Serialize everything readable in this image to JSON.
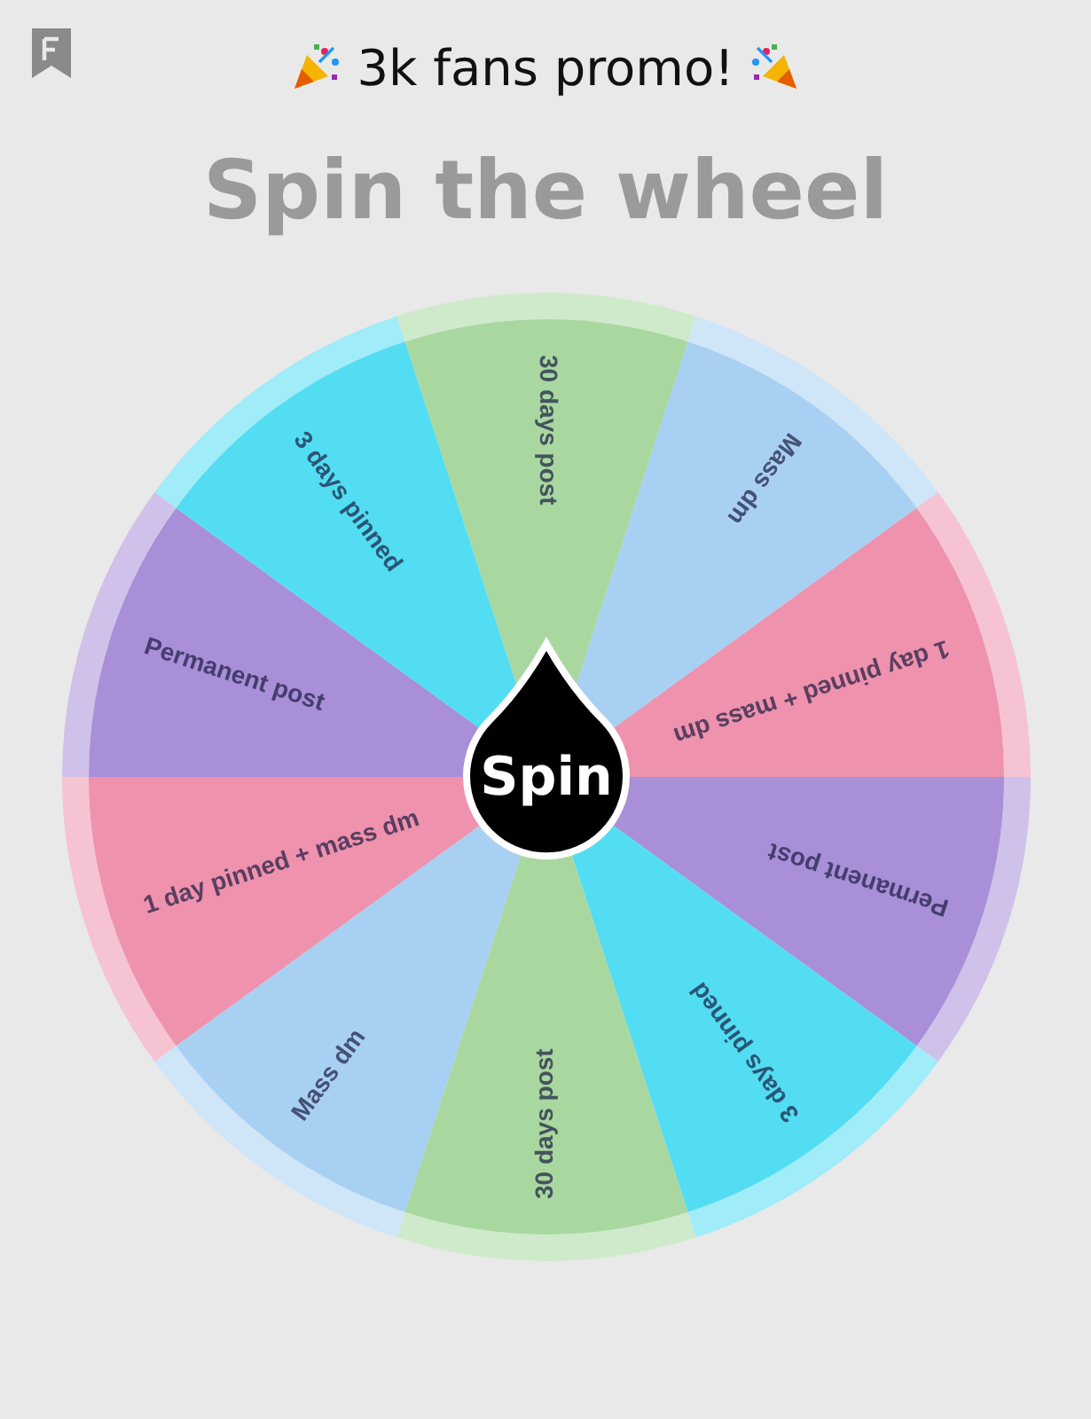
{
  "header": {
    "title": "3k fans promo!"
  },
  "heading": "Spin the wheel",
  "wheel": {
    "button": "Spin",
    "segments": [
      {
        "label": "30 days post",
        "color": "#a8d8a0"
      },
      {
        "label": "Mass dm",
        "color": "#a8d0f2"
      },
      {
        "label": "1 day pinned + mass dm",
        "color": "#ee92ad"
      },
      {
        "label": "Permanent post",
        "color": "#a88fd8"
      },
      {
        "label": "3 days pinned",
        "color": "#52ddf2"
      },
      {
        "label": "30 days post",
        "color": "#a8d8a0"
      },
      {
        "label": "Mass dm",
        "color": "#a8d0f2"
      },
      {
        "label": "1 day pinned + mass dm",
        "color": "#ee92ad"
      },
      {
        "label": "Permanent post",
        "color": "#a88fd8"
      },
      {
        "label": "3 days pinned",
        "color": "#52ddf2"
      }
    ]
  }
}
